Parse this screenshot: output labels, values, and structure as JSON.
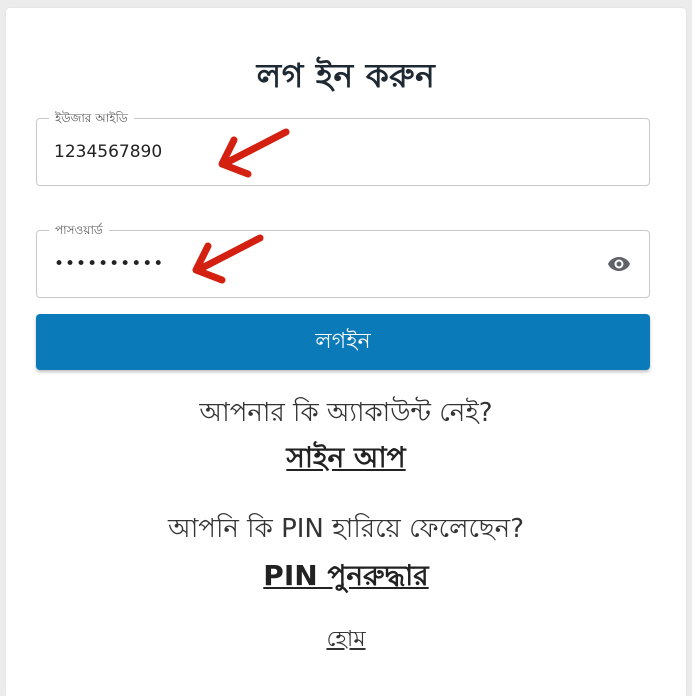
{
  "title": "লগ ইন করুন",
  "user_field": {
    "label": "ইউজার আইডি",
    "value": "1234567890"
  },
  "password_field": {
    "label": "পাসওয়ার্ড",
    "value": "••••••••••",
    "toggle_icon": "eye-icon"
  },
  "login_button": "লগইন",
  "signup_prompt": "আপনার কি অ্যাকাউন্ট নেই?",
  "signup_link": "সাইন আপ",
  "pin_prompt": "আপনি কি PIN হারিয়ে ফেলেছেন?",
  "pin_link": "PIN পুনরুদ্ধার",
  "home_link": "হোম",
  "colors": {
    "primary": "#0b7ab8",
    "annotation_arrow": "#d42010"
  }
}
